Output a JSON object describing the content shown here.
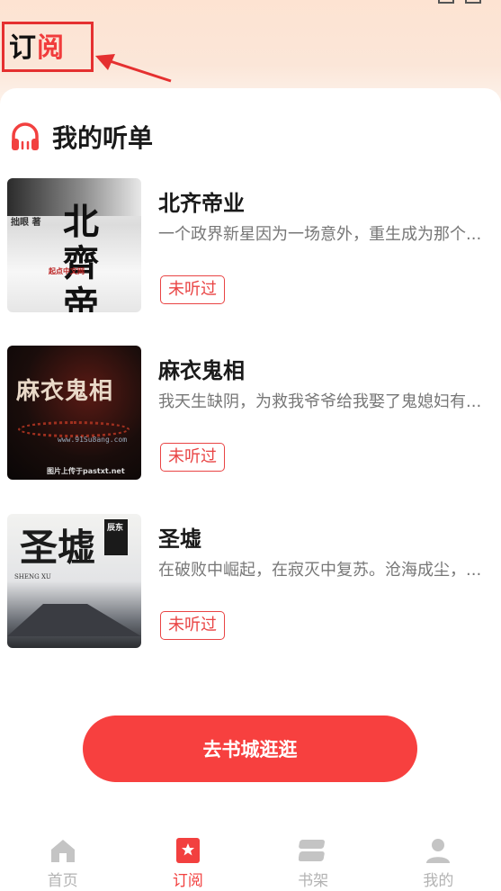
{
  "header": {
    "title_part1": "订",
    "title_part2": "阅"
  },
  "section": {
    "title": "我的听单"
  },
  "books": [
    {
      "title": "北齐帝业",
      "desc": "一个政界新星因为一场意外，重生成为那个...",
      "badge": "未听过",
      "cover": {
        "author": "拙眼 著",
        "art": "北齊帝業",
        "publisher": "起点中文网"
      }
    },
    {
      "title": "麻衣鬼相",
      "desc": "我天生缺阴，为救我爷爷给我娶了鬼媳妇有...",
      "badge": "未听过",
      "cover": {
        "art": "麻衣鬼相",
        "url": "www.91Su8ang.com",
        "caption": "图片上传于pastxt.net"
      }
    },
    {
      "title": "圣墟",
      "desc": "在破败中崛起，在寂灭中复苏。沧海成尘，...",
      "badge": "未听过",
      "cover": {
        "art": "圣墟",
        "romanized": "SHENG XU",
        "side": "辰东"
      }
    }
  ],
  "cta": {
    "label": "去书城逛逛"
  },
  "tabs": [
    {
      "label": "首页",
      "icon": "home-icon",
      "active": false
    },
    {
      "label": "订阅",
      "icon": "bookmark-icon",
      "active": true
    },
    {
      "label": "书架",
      "icon": "bookshelf-icon",
      "active": false
    },
    {
      "label": "我的",
      "icon": "user-icon",
      "active": false
    }
  ],
  "colors": {
    "accent": "#f7403f",
    "inactive_tab": "#b3b3b3",
    "annotation": "#e53030"
  }
}
